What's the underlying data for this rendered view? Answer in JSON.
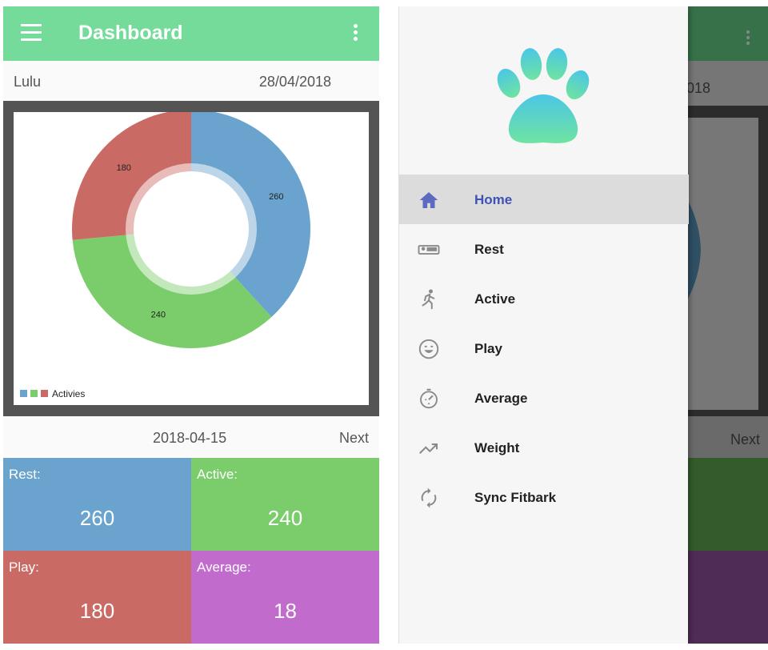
{
  "dashboard": {
    "title": "Dashboard",
    "pet_name": "Lulu",
    "date": "28/04/2018",
    "range_date": "2018-04-15",
    "next_label": "Next",
    "legend_label": "Activies",
    "tiles": [
      {
        "label": "Rest:",
        "value": "260",
        "color": "#6aa3cd"
      },
      {
        "label": "Active:",
        "value": "240",
        "color": "#7bcd6b"
      },
      {
        "label": "Play:",
        "value": "180",
        "color": "#c96a65"
      },
      {
        "label": "Average:",
        "value": "18",
        "color": "#c16ccd"
      }
    ]
  },
  "chart_data": {
    "type": "pie",
    "categories": [
      "Rest",
      "Active",
      "Play"
    ],
    "values": [
      260,
      240,
      180
    ],
    "colors": [
      "#6aa3cd",
      "#7bcd6b",
      "#c96a65"
    ],
    "legend": "Activies",
    "legend_position": "bottom-left",
    "hole": true
  },
  "drawer": {
    "items": [
      {
        "label": "Home",
        "icon": "home-icon",
        "active": true
      },
      {
        "label": "Rest",
        "icon": "bed-icon",
        "active": false
      },
      {
        "label": "Active",
        "icon": "run-icon",
        "active": false
      },
      {
        "label": "Play",
        "icon": "smile-icon",
        "active": false
      },
      {
        "label": "Average",
        "icon": "timer-icon",
        "active": false
      },
      {
        "label": "Weight",
        "icon": "trending-up-icon",
        "active": false
      },
      {
        "label": "Sync Fitbark",
        "icon": "sync-icon",
        "active": false
      }
    ]
  },
  "background": {
    "date_partial": "/2018",
    "next_label": "Next"
  },
  "theme": {
    "accent": "#74db9a",
    "drawer_active": "#3f51b5"
  }
}
